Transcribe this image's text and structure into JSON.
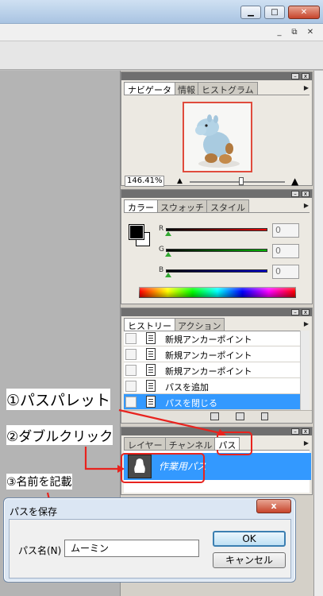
{
  "window": {
    "minimize": "▁",
    "maximize": "□",
    "close": "✕",
    "mdi_minimize": "_",
    "mdi_restore": "⧉",
    "mdi_close": "✕"
  },
  "navigator": {
    "tabs": [
      "ナビゲータ",
      "情報",
      "ヒストグラム"
    ],
    "zoom": "146.41%"
  },
  "color": {
    "tabs": [
      "カラー",
      "スウォッチ",
      "スタイル"
    ],
    "sliders": [
      {
        "label": "R",
        "value": "0",
        "color": "#e80000"
      },
      {
        "label": "G",
        "value": "0",
        "color": "#00b400"
      },
      {
        "label": "B",
        "value": "0",
        "color": "#0000d0"
      }
    ]
  },
  "history": {
    "tabs": [
      "ヒストリー",
      "アクション"
    ],
    "items": [
      "新規アンカーポイント",
      "新規アンカーポイント",
      "新規アンカーポイント",
      "パスを追加",
      "パスを閉じる"
    ]
  },
  "layers": {
    "tabs": [
      "レイヤー",
      "チャンネル",
      "パス"
    ],
    "path_name": "作業用パス"
  },
  "annotations": {
    "step1": "①パスパレット",
    "step2": "②ダブルクリック",
    "step3": "③名前を記載"
  },
  "dialog": {
    "title": "パスを保存",
    "name_label": "パス名(N)",
    "name_value": "ムーミン",
    "ok": "OK",
    "cancel": "キャンセル",
    "close": "x"
  },
  "colors": {
    "accent_red": "#e8231e",
    "selection": "#3399ff"
  }
}
